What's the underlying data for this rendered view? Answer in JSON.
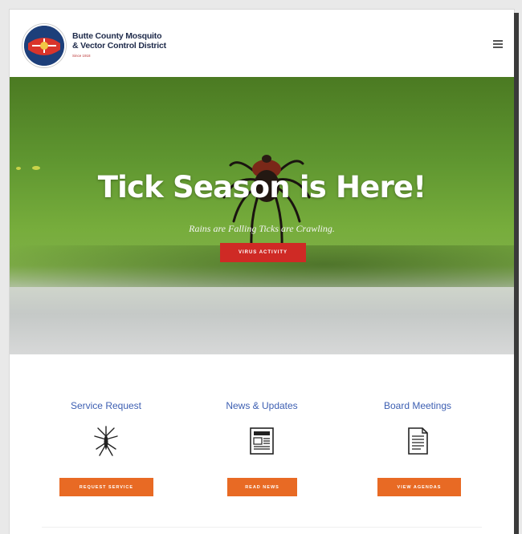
{
  "header": {
    "brand_line1": "Butte County Mosquito",
    "brand_line2": "& Vector Control District",
    "brand_line3": "Since 1918"
  },
  "hero": {
    "title": "Tick Season is Here!",
    "subtitle": "Rains are Falling Ticks are Crawling.",
    "cta_label": "VIRUS ACTIVITY"
  },
  "features": [
    {
      "title": "Service Request",
      "icon": "mosquito-icon",
      "button_label": "REQUEST SERVICE"
    },
    {
      "title": "News & Updates",
      "icon": "newspaper-icon",
      "button_label": "READ NEWS"
    },
    {
      "title": "Board Meetings",
      "icon": "document-icon",
      "button_label": "VIEW AGENDAS"
    }
  ],
  "colors": {
    "cta_red": "#cf2a25",
    "button_orange": "#e86a24",
    "link_blue": "#3d5fb2",
    "brand_navy": "#1e2a4a"
  }
}
